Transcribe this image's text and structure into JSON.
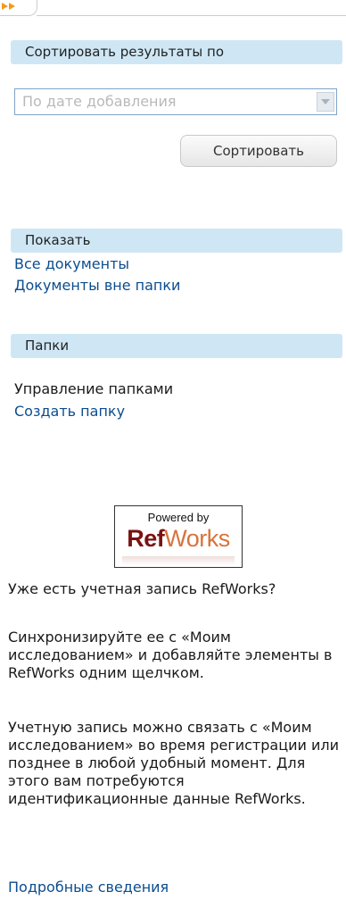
{
  "sort_section": {
    "header": "Сортировать результаты по",
    "select_value": "По дате добавления",
    "button_label": "Сортировать"
  },
  "show_section": {
    "header": "Показать",
    "links": [
      "Все документы",
      "Документы вне папки"
    ]
  },
  "folders_section": {
    "header": "Папки",
    "manage_label": "Управление папками",
    "create_link": "Создать папку"
  },
  "refworks": {
    "logo_powered": "Powered by",
    "logo_ref": "Ref",
    "logo_works": "Works",
    "question": "Уже есть учетная запись RefWorks?",
    "sync_text": "Синхронизируйте ее с «Моим исследованием» и добавляйте элементы в RefWorks одним щелчком.",
    "link_text": "Учетную запись можно связать с «Моим исследованием» во время регистрации или позднее в любой удобный момент. Для этого вам потребуются идентификационные данные RefWorks.",
    "more_link": "Подробные сведения"
  },
  "colors": {
    "header_bg": "#cfe7f5",
    "link": "#0c4d8f",
    "accent_arrow": "#f39a1a"
  }
}
